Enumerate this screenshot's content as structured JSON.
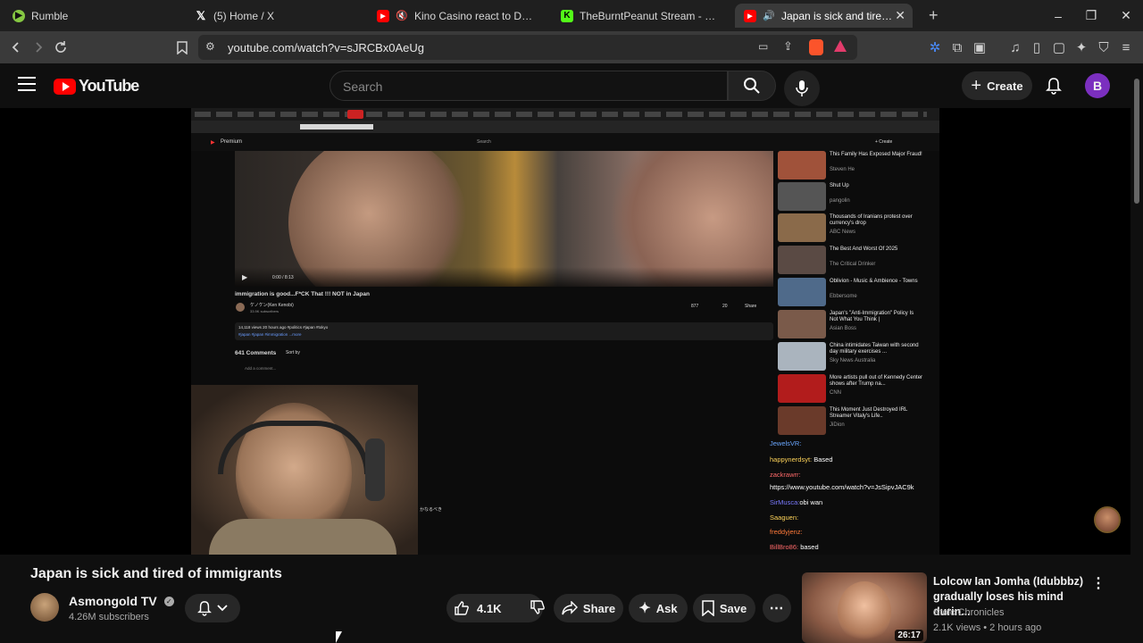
{
  "browser": {
    "tabs": [
      {
        "title": "Rumble",
        "icon": "rumble-icon",
        "color": "#85c742"
      },
      {
        "title": "(5) Home / X",
        "icon": "x-icon",
        "color": "#ffffff"
      },
      {
        "title": "Kino Casino react to DSPgaming's",
        "icon": "youtube-icon",
        "color": "#ff0000"
      },
      {
        "title": "TheBurntPeanut Stream - Watch Live",
        "icon": "kick-icon",
        "color": "#53fc18"
      },
      {
        "title": "Japan is sick and tired of imm",
        "icon": "youtube-icon",
        "color": "#ff0000",
        "active": true
      }
    ],
    "url": "youtube.com/watch?v=sJRCBx0AeUg",
    "new_tab": "+",
    "window_controls": [
      "–",
      "❐",
      "✕"
    ]
  },
  "youtube": {
    "logo_text": "YouTube",
    "search_placeholder": "Search",
    "create_label": "Create",
    "avatar_letter": "B"
  },
  "embedded": {
    "yt_premium": "Premium",
    "search": "Search",
    "create": "+ Create",
    "video_time": "0:00 / 8:13",
    "video_title": "immigration is good...F*CK That !!! NOT in Japan",
    "channel": "ケノケン(Ken Kenobi)",
    "channel_subs": "33.9K subscribers",
    "likes": "877",
    "dislikes": "20",
    "share": "Share",
    "views": "14,118 views  20 hours ago  #politics #japan #tokyo",
    "tags": "#japan #japan #immigration ...more",
    "comments": "641 Comments",
    "sort": "Sort by",
    "add_comment": "Add a comment...",
    "related": [
      {
        "title": "This Family Has Exposed Major Fraud!",
        "meta": "Steven He",
        "color": "#a0523a"
      },
      {
        "title": "Shut Up",
        "meta": "pangolin",
        "color": "#555"
      },
      {
        "title": "Thousands of Iranians protest over currency's drop",
        "meta": "ABC News",
        "color": "#8a6a4a"
      },
      {
        "title": "The Best And Worst Of 2025",
        "meta": "The Critical Drinker",
        "color": "#5a4a44"
      },
      {
        "title": "Oblivion - Music & Ambience - Towns",
        "meta": "Ebbersome",
        "color": "#4f6a8a"
      },
      {
        "title": "Japan's \"Anti-Immigration\" Policy Is Not What You Think |",
        "meta": "Asian Boss",
        "color": "#7a5a4a"
      },
      {
        "title": "China intimidates Taiwan with second day military exercises ...",
        "meta": "Sky News Australia",
        "color": "#aab4be"
      },
      {
        "title": "More artists pull out of Kennedy Center shows after Trump na...",
        "meta": "CNN",
        "color": "#b21c1c"
      },
      {
        "title": "This Moment Just Destroyed IRL Streamer Vitaly's Life..",
        "meta": "JiDion",
        "color": "#6a3a2a"
      }
    ],
    "chat": [
      {
        "user": "JewelsVR:",
        "msg": "",
        "color": "#6aa7ff"
      },
      {
        "user": "happynerdsyt:",
        "msg": "Based",
        "color": "#ffd45a"
      },
      {
        "user": "zackrawrr:",
        "msg": "",
        "color": "#ff6a6a"
      },
      {
        "user": "",
        "msg": "https://www.youtube.com/watch?v=JsSipvJAC9k",
        "color": "#ffffff"
      },
      {
        "user": "SirMusca:",
        "msg": "obi wan",
        "color": "#7a7aff"
      },
      {
        "user": "Saaguen:",
        "msg": "",
        "color": "#ffd45a"
      },
      {
        "user": "freddyjenz:",
        "msg": "",
        "color": "#ff7a3a"
      },
      {
        "user": "BillBro86:",
        "msg": "based",
        "color": "#ff6a6a"
      }
    ],
    "cam_overlay": "かなるべき"
  },
  "video": {
    "title": "Japan is sick and tired of immigrants",
    "channel": "Asmongold TV",
    "subscribers": "4.26M subscribers",
    "likes": "4.1K",
    "share": "Share",
    "ask": "Ask",
    "save": "Save"
  },
  "sidebar_video": {
    "title": "Lolcow Ian Jomha (Idubbbz) gradually loses his mind durin...",
    "channel": "Stoic Chronicles",
    "meta": "2.1K views • 2 hours ago",
    "duration": "26:17"
  }
}
